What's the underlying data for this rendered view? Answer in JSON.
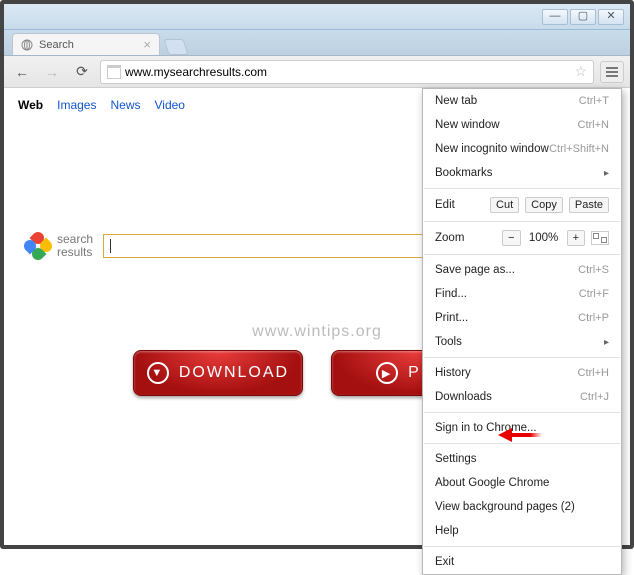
{
  "window": {
    "min": "—",
    "max": "▢",
    "close": "✕"
  },
  "tab": {
    "title": "Search"
  },
  "toolbar": {
    "url": "www.mysearchresults.com"
  },
  "nav": {
    "web": "Web",
    "images": "Images",
    "news": "News",
    "video": "Video"
  },
  "logo": {
    "line1": "search",
    "line2": "results"
  },
  "watermark": "www.wintips.org",
  "buttons": {
    "download": "DOWNLOAD",
    "play": "PLAY"
  },
  "menu": {
    "new_tab": {
      "label": "New tab",
      "shortcut": "Ctrl+T"
    },
    "new_window": {
      "label": "New window",
      "shortcut": "Ctrl+N"
    },
    "incognito": {
      "label": "New incognito window",
      "shortcut": "Ctrl+Shift+N"
    },
    "bookmarks": {
      "label": "Bookmarks"
    },
    "edit": {
      "label": "Edit",
      "cut": "Cut",
      "copy": "Copy",
      "paste": "Paste"
    },
    "zoom": {
      "label": "Zoom",
      "minus": "−",
      "level": "100%",
      "plus": "+"
    },
    "save": {
      "label": "Save page as...",
      "shortcut": "Ctrl+S"
    },
    "find": {
      "label": "Find...",
      "shortcut": "Ctrl+F"
    },
    "print": {
      "label": "Print...",
      "shortcut": "Ctrl+P"
    },
    "tools": {
      "label": "Tools"
    },
    "history": {
      "label": "History",
      "shortcut": "Ctrl+H"
    },
    "downloads": {
      "label": "Downloads",
      "shortcut": "Ctrl+J"
    },
    "signin": {
      "label": "Sign in to Chrome..."
    },
    "settings": {
      "label": "Settings"
    },
    "about": {
      "label": "About Google Chrome"
    },
    "bgpages": {
      "label": "View background pages (2)"
    },
    "help": {
      "label": "Help"
    },
    "exit": {
      "label": "Exit"
    }
  }
}
